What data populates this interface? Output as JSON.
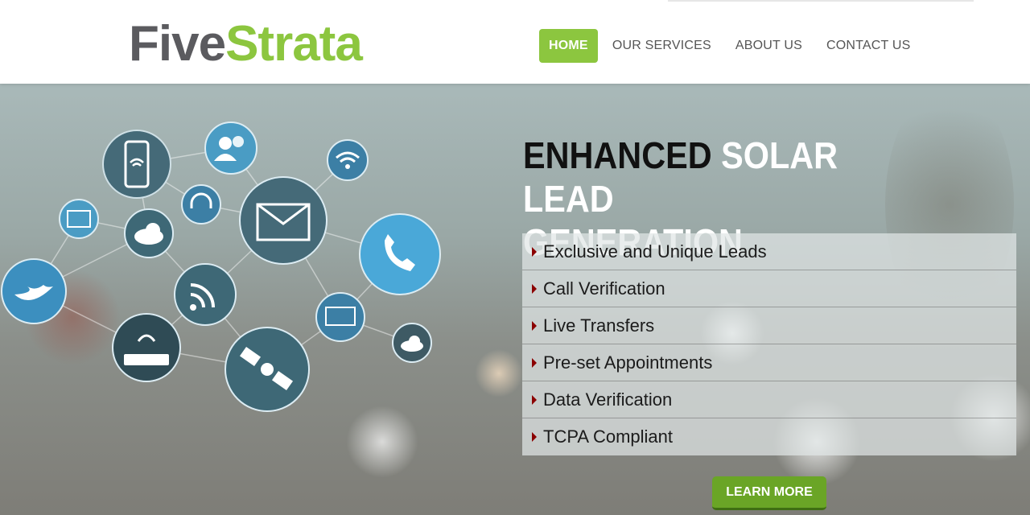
{
  "logo": {
    "part1": "Five",
    "part2": "Strata"
  },
  "nav": [
    {
      "label": "HOME",
      "active": true
    },
    {
      "label": "OUR SERVICES",
      "active": false
    },
    {
      "label": "ABOUT US",
      "active": false
    },
    {
      "label": "CONTACT US",
      "active": false
    }
  ],
  "hero": {
    "headline_dark": "ENHANCED",
    "headline_light_1": "SOLAR LEAD",
    "headline_light_2": "GENERATION",
    "features": [
      "Exclusive and Unique Leads",
      "Call Verification",
      "Live Transfers",
      "Pre-set Appointments",
      "Data Verification",
      "TCPA Compliant"
    ],
    "cta_label": "LEARN MORE"
  },
  "colors": {
    "brand_green": "#8cc63f",
    "brand_gray": "#5b5b5f",
    "cta_green": "#6aa526",
    "arrow_red": "#8b0000"
  },
  "icons": [
    "smartphone-wifi-icon",
    "users-icon",
    "wifi-icon",
    "headset-icon",
    "fax-icon",
    "cloud-download-icon",
    "envelope-icon",
    "phone-icon",
    "twitter-bird-icon",
    "rss-icon",
    "laptop-wifi-icon",
    "router-icon",
    "satellite-icon",
    "cloud-icon"
  ]
}
